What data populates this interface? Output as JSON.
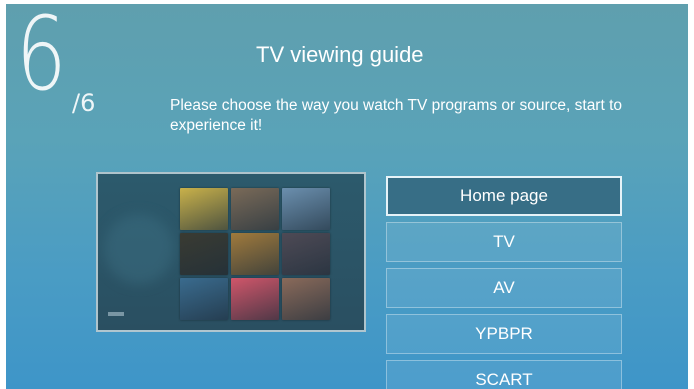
{
  "guide": {
    "step_current": "6",
    "step_total": "/6",
    "title": "TV viewing guide",
    "subtitle": "Please choose the way you watch TV programs or source, start to experience it!"
  },
  "preview": {
    "tile_colors": [
      "#c9b14a",
      "#7a6a58",
      "#6b8fae",
      "#3a3b32",
      "#a07a3c",
      "#4e4a55",
      "#3a6b8e",
      "#d0566a",
      "#8a6a5a"
    ]
  },
  "menu": {
    "selected_index": 0,
    "items": [
      {
        "label": "Home page"
      },
      {
        "label": "TV"
      },
      {
        "label": "AV"
      },
      {
        "label": "YPBPR"
      },
      {
        "label": "SCART"
      }
    ]
  },
  "colors": {
    "background_top": "#5f9fae",
    "background_bottom": "#3e95c8",
    "selected_item": "#376e86"
  }
}
